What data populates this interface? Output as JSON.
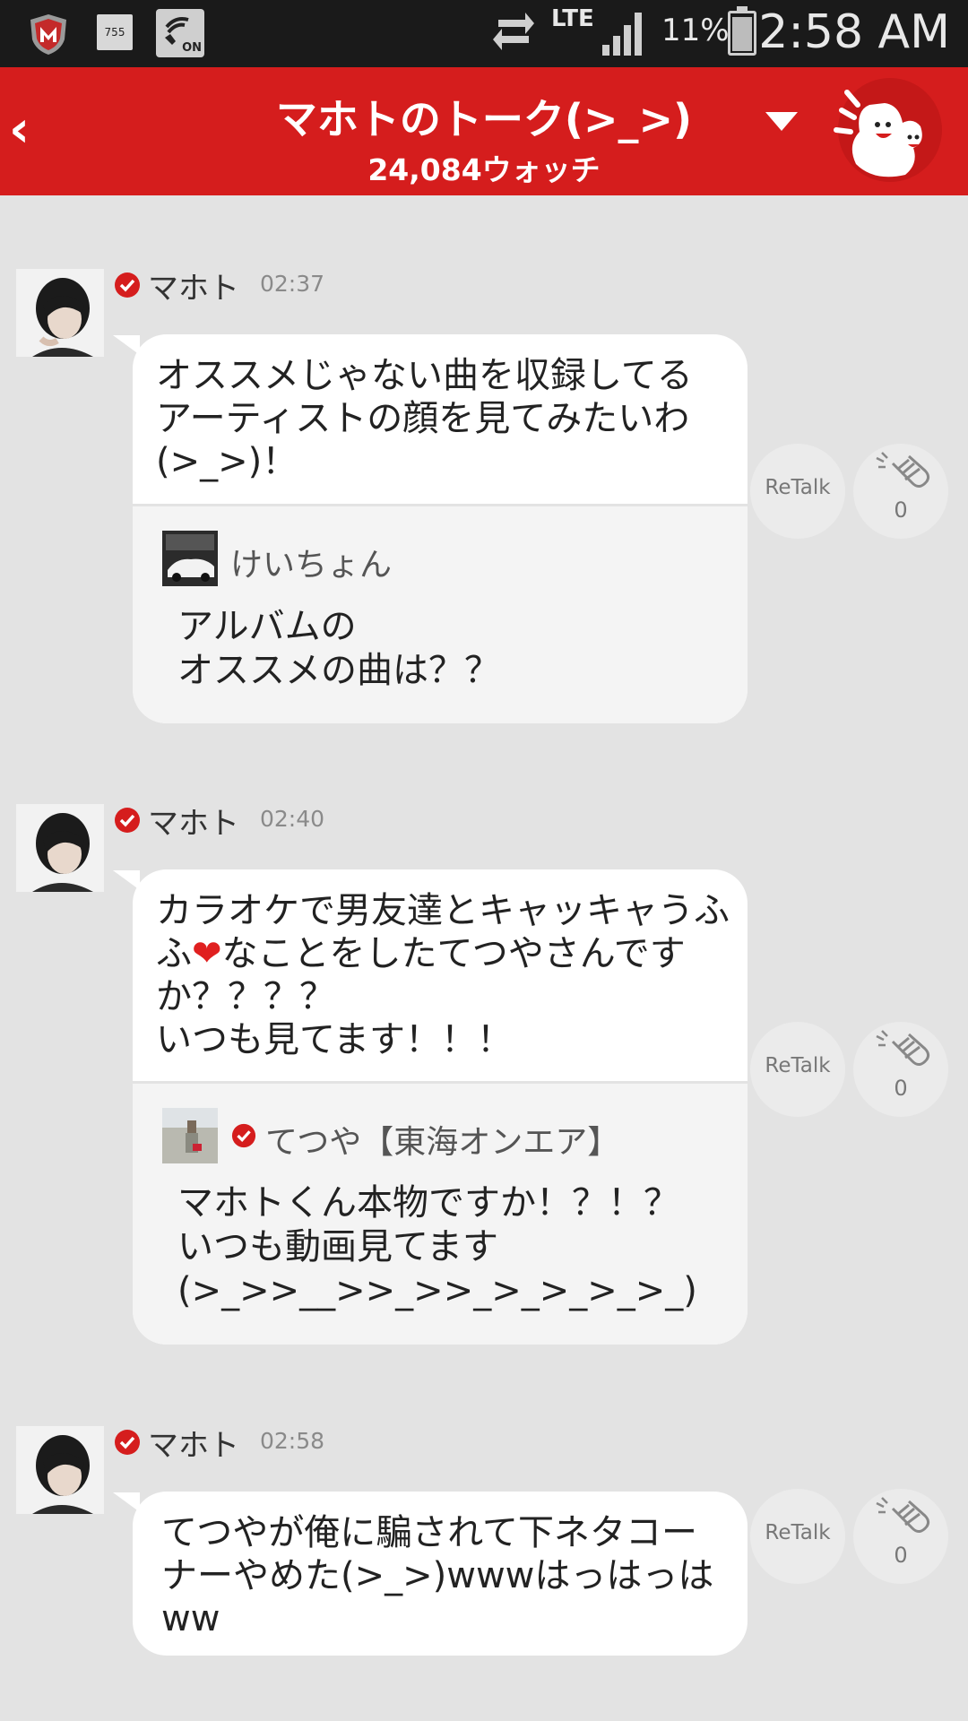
{
  "status_bar": {
    "app_icon_text": "755",
    "wifi_badge": "ON",
    "network": "LTE",
    "battery": "11%",
    "time": "2:58 AM"
  },
  "header": {
    "title": "マホトのトーク(>_>)",
    "subtitle": "24,084ウォッチ"
  },
  "messages": [
    {
      "name": "マホト",
      "time": "02:37",
      "text": "オススメじゃない曲を収録してる\nアーティストの顔を見てみたいわ\n(>_>)！",
      "reply_name": "けいちょん",
      "reply_text": "アルバムの\nオススメの曲は？？",
      "retalk_label": "ReTalk",
      "clap_count": "0"
    },
    {
      "name": "マホト",
      "time": "02:40",
      "text_a": "カラオケで男友達とキャッキャうふ\nふ",
      "text_heart": "❤",
      "text_b": "なことをしたてつやさんです\nか？？？？\nいつも見てます！！！",
      "reply_name": "てつや【東海オンエア】",
      "reply_text": "マホトくん本物ですか！？！？\nいつも動画見てます\n(>_>>__>>_>>_>_>_>_>_)",
      "retalk_label": "ReTalk",
      "clap_count": "0"
    },
    {
      "name": "マホト",
      "time": "02:58",
      "text": "てつやが俺に騙されて下ネタコー\nナーやめた(>_>)wwwはっはっは\nww",
      "retalk_label": "ReTalk",
      "clap_count": "0"
    }
  ],
  "colors": {
    "header_red": "#d51d1d",
    "background": "#e3e3e3",
    "verified_red": "#d51d1d"
  }
}
